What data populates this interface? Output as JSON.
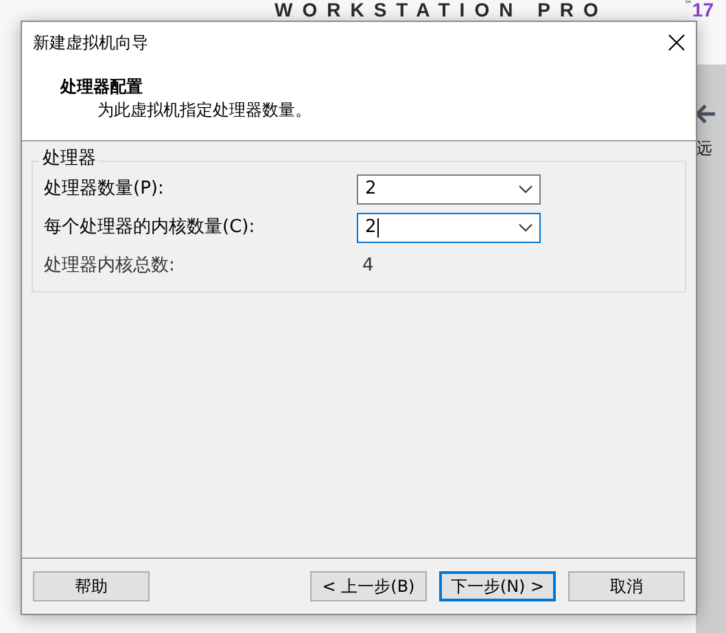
{
  "background": {
    "brand": "WORKSTATION PRO",
    "trademark": "™",
    "version": "17",
    "side_label": "远"
  },
  "window": {
    "title": "新建虚拟机向导"
  },
  "header": {
    "title": "处理器配置",
    "subtitle": "为此虚拟机指定处理器数量。"
  },
  "group": {
    "title": "处理器",
    "fields": [
      {
        "kind": "combo",
        "label": "处理器数量(P):",
        "value": "2",
        "focused": false
      },
      {
        "kind": "combo",
        "label": "每个处理器的内核数量(C):",
        "value": "2",
        "focused": true
      },
      {
        "kind": "readout",
        "label": "处理器内核总数:",
        "value": "4"
      }
    ]
  },
  "buttons": [
    {
      "label": "帮助",
      "default": false
    },
    {
      "label": "< 上一步(B)",
      "default": false
    },
    {
      "label": "下一步(N) >",
      "default": true
    },
    {
      "label": "取消",
      "default": false
    }
  ]
}
